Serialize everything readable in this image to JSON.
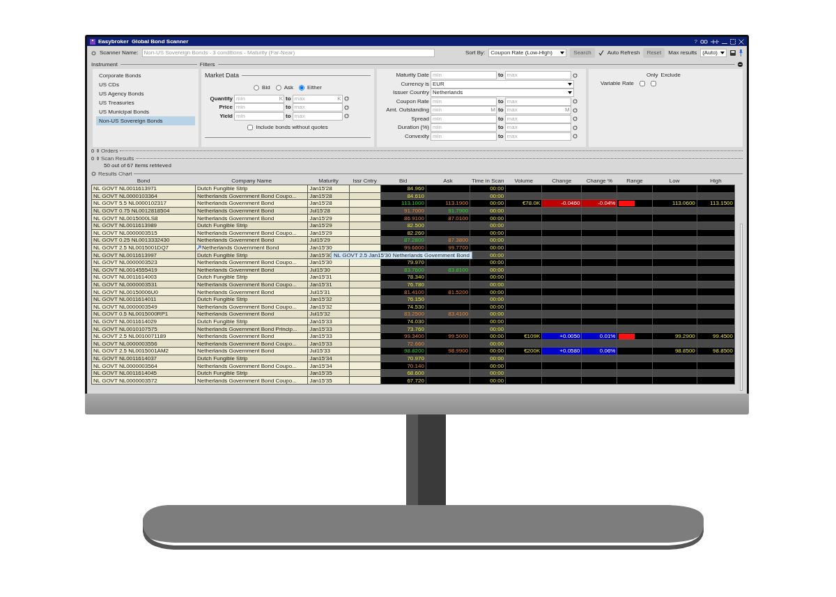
{
  "window": {
    "title": "Easybroker  Global Bond Scanner",
    "help": "?"
  },
  "toolbar": {
    "scanner_name_label": "Scanner Name:",
    "scanner_name": "Non-US Sovereign Bonds - 3 conditions - Maturity (Far-Near)",
    "sort_by_label": "Sort By:",
    "sort_by": "Coupon Rate (Low-High)",
    "search_button": "Search",
    "auto_refresh": {
      "label": "Auto Refresh",
      "checked": true
    },
    "reset_button": "Reset",
    "max_results_label": "Max results",
    "max_results": "(Auto)"
  },
  "instrument": {
    "label": "Instrument",
    "items": [
      {
        "label": "Corporate Bonds",
        "selected": false
      },
      {
        "label": "US CDs",
        "selected": false
      },
      {
        "label": "US Agency Bonds",
        "selected": false
      },
      {
        "label": "US Treasuries",
        "selected": false
      },
      {
        "label": "US Municipal Bonds",
        "selected": false
      },
      {
        "label": "Non-US Sovereign Bonds",
        "selected": true
      }
    ]
  },
  "filters": {
    "label": "Filters",
    "market_data": {
      "title": "Market Data",
      "quote_sides": [
        {
          "label": "Bid",
          "selected": false
        },
        {
          "label": "Ask",
          "selected": false
        },
        {
          "label": "Either",
          "selected": true
        }
      ],
      "rows": [
        {
          "label": "Quantity",
          "min_placeholder": "min",
          "max_placeholder": "max",
          "to": "to",
          "min_unit": "K",
          "max_unit": "K"
        },
        {
          "label": "Price",
          "min_placeholder": "min",
          "max_placeholder": "max",
          "to": "to"
        },
        {
          "label": "Yield",
          "min_placeholder": "min",
          "max_placeholder": "max",
          "to": "to"
        }
      ],
      "include_without_quotes": {
        "label": "Include bonds without quotes",
        "checked": false
      }
    },
    "criteria": [
      {
        "kind": "range",
        "label": "Maturity Date",
        "min_placeholder": "min",
        "max_placeholder": "max",
        "to": "to"
      },
      {
        "kind": "select",
        "label": "Currency is",
        "value": "EUR"
      },
      {
        "kind": "select",
        "label": "Issuer Country",
        "value": "Netherlands"
      },
      {
        "kind": "range",
        "label": "Coupon Rate",
        "min_placeholder": "min",
        "max_placeholder": "max",
        "to": "to"
      },
      {
        "kind": "range",
        "label": "Amt. Outstanding",
        "min_placeholder": "min",
        "max_placeholder": "max",
        "to": "to",
        "min_unit": "M",
        "max_unit": "M"
      },
      {
        "kind": "range",
        "label": "Spread",
        "min_placeholder": "min",
        "max_placeholder": "max",
        "to": "to"
      },
      {
        "kind": "range",
        "label": "Duration (%)",
        "min_placeholder": "min",
        "max_placeholder": "max",
        "to": "to"
      },
      {
        "kind": "range",
        "label": "Convexity",
        "min_placeholder": "min",
        "max_placeholder": "max",
        "to": "to"
      }
    ],
    "flags": {
      "headers": [
        "Only",
        "Exclude"
      ],
      "items": [
        {
          "label": "Variable Rate",
          "only": false,
          "exclude": false
        }
      ]
    }
  },
  "sections": [
    {
      "label": "Orders"
    },
    {
      "label": "Scan Results"
    }
  ],
  "scan_status": "50 out of 67 items retrieved",
  "results_chart": {
    "label": "Results Chart"
  },
  "table": {
    "columns": [
      "Bond",
      "Company Name",
      "Maturity",
      "Issr Cntry",
      "Bid",
      "Ask",
      "Time in Scan",
      "Volume",
      "Change",
      "Change %",
      "Range",
      "Low",
      "High"
    ],
    "rows": [
      {
        "bond": "NL GOVT NL0011613971",
        "company": "Dutch Fungible Strip",
        "maturity": "Jan15'28",
        "bid": {
          "text": "84.960",
          "kind": "flat"
        },
        "time": "00:00",
        "arrow": false,
        "range": false
      },
      {
        "bond": "NL GOVT NL0000103364",
        "company": "Netherlands Government Bond Coupo...",
        "maturity": "Jan15'28",
        "bid": {
          "text": "84.610",
          "kind": "flat"
        },
        "time": "00:00",
        "arrow": false,
        "range": false
      },
      {
        "bond": "NL GOVT 5.5 NL0000102317",
        "company": "Netherlands Government Bond",
        "maturity": "Jan15'28",
        "bid": {
          "text": "113.1000",
          "kind": "up"
        },
        "ask": {
          "text": "113.1900",
          "kind": "down"
        },
        "time": "00:00",
        "volume": "€78.0K",
        "change": {
          "text": "-0.0460",
          "color": "#c00000"
        },
        "change_pct": {
          "text": "-0.04%",
          "color": "#c00000"
        },
        "arrow": false,
        "range": true,
        "low": "113.0600",
        "high": "113.1500"
      },
      {
        "bond": "NL GOVT 0.75 NL0012818504",
        "company": "Netherlands Government Bond",
        "maturity": "Jul15'28",
        "bid": {
          "text": "91.7000",
          "kind": "down"
        },
        "ask": {
          "text": "91.7900",
          "kind": "up"
        },
        "time": "00:00",
        "arrow": false,
        "range": false
      },
      {
        "bond": "NL GOVT NL0015000LS8",
        "company": "Netherlands Government Bond",
        "maturity": "Jan15'29",
        "bid": {
          "text": "86.9100",
          "kind": "down"
        },
        "ask": {
          "text": "87.0100",
          "kind": "down"
        },
        "time": "00:00",
        "arrow": false,
        "range": false
      },
      {
        "bond": "NL GOVT NL0011613989",
        "company": "Dutch Fungible Strip",
        "maturity": "Jan15'29",
        "bid": {
          "text": "82.500",
          "kind": "flat"
        },
        "time": "00:00",
        "arrow": false,
        "range": false
      },
      {
        "bond": "NL GOVT NL0000003515",
        "company": "Netherlands Government Bond Coupo...",
        "maturity": "Jan15'29",
        "bid": {
          "text": "82.260",
          "kind": "flat"
        },
        "time": "00:00",
        "arrow": false,
        "range": false
      },
      {
        "bond": "NL GOVT 0.25 NL0013332430",
        "company": "Netherlands Government Bond",
        "maturity": "Jul15'29",
        "bid": {
          "text": "87.2800",
          "kind": "up"
        },
        "ask": {
          "text": "87.3800",
          "kind": "down"
        },
        "time": "00:00",
        "arrow": false,
        "range": false
      },
      {
        "bond": "NL GOVT 2.5 NL0015001DQ7",
        "company": "Netherlands Government Bond",
        "maturity": "Jan15'30",
        "bid": {
          "text": "99.6600",
          "kind": "down"
        },
        "ask": {
          "text": "99.7700",
          "kind": "down"
        },
        "time": "00:00",
        "arrow": true,
        "range": false
      },
      {
        "bond": "NL GOVT NL0011613997",
        "company": "Dutch Fungible Strip",
        "maturity": "Jan15'30",
        "time": "00:00",
        "arrow": false,
        "range": false
      },
      {
        "bond": "NL GOVT NL0000003523",
        "company": "Netherlands Government Bond Coupo...",
        "maturity": "Jan15'30",
        "bid": {
          "text": "79.970",
          "kind": "flat"
        },
        "time": "00:00",
        "arrow": false,
        "range": false
      },
      {
        "bond": "NL GOVT NL0014555419",
        "company": "Netherlands Government Bond",
        "maturity": "Jul15'30",
        "bid": {
          "text": "83.7600",
          "kind": "up"
        },
        "ask": {
          "text": "83.8100",
          "kind": "up"
        },
        "time": "00:00",
        "arrow": false,
        "range": false
      },
      {
        "bond": "NL GOVT NL0011614003",
        "company": "Dutch Fungible Strip",
        "maturity": "Jan15'31",
        "bid": {
          "text": "78.340",
          "kind": "flat"
        },
        "time": "00:00",
        "arrow": false,
        "range": false
      },
      {
        "bond": "NL GOVT NL0000003531",
        "company": "Netherlands Government Bond Coupo...",
        "maturity": "Jan15'31",
        "bid": {
          "text": "76.780",
          "kind": "flat"
        },
        "time": "00:00",
        "arrow": false,
        "range": false
      },
      {
        "bond": "NL GOVT NL00150006U0",
        "company": "Netherlands Government Bond",
        "maturity": "Jul15'31",
        "bid": {
          "text": "81.4100",
          "kind": "down"
        },
        "ask": {
          "text": "81.5200",
          "kind": "down"
        },
        "time": "00:00",
        "arrow": false,
        "range": false
      },
      {
        "bond": "NL GOVT NL0011614011",
        "company": "Dutch Fungible Strip",
        "maturity": "Jan15'32",
        "bid": {
          "text": "76.150",
          "kind": "flat"
        },
        "time": "00:00",
        "arrow": false,
        "range": false
      },
      {
        "bond": "NL GOVT NL0000003549",
        "company": "Netherlands Government Bond Coupo...",
        "maturity": "Jan15'32",
        "bid": {
          "text": "74.530",
          "kind": "flat"
        },
        "time": "00:00",
        "arrow": false,
        "range": false
      },
      {
        "bond": "NL GOVT 0.5 NL0015000RP1",
        "company": "Netherlands Government Bond",
        "maturity": "Jul15'32",
        "bid": {
          "text": "83.2500",
          "kind": "down"
        },
        "ask": {
          "text": "83.4100",
          "kind": "down"
        },
        "time": "00:00",
        "arrow": false,
        "range": false
      },
      {
        "bond": "NL GOVT NL0011614029",
        "company": "Dutch Fungible Strip",
        "maturity": "Jan15'33",
        "bid": {
          "text": "74.030",
          "kind": "flat"
        },
        "time": "00:00",
        "arrow": false,
        "range": false
      },
      {
        "bond": "NL GOVT NL0010107575",
        "company": "Netherlands Government Bond Princip...",
        "maturity": "Jan15'33",
        "bid": {
          "text": "73.760",
          "kind": "flat"
        },
        "time": "00:00",
        "arrow": false,
        "range": false
      },
      {
        "bond": "NL GOVT 2.5 NL0010071189",
        "company": "Netherlands Government Bond",
        "maturity": "Jan15'33",
        "bid": {
          "text": "99.3400",
          "kind": "down"
        },
        "ask": {
          "text": "99.5000",
          "kind": "down"
        },
        "time": "00:00",
        "volume": "€109K",
        "change": {
          "text": "+0.0050",
          "color": "#0000cc"
        },
        "change_pct": {
          "text": "0.01%",
          "color": "#0000cc"
        },
        "arrow": false,
        "range": true,
        "low": "99.2900",
        "high": "99.4500"
      },
      {
        "bond": "NL GOVT NL0000003556",
        "company": "Netherlands Government Bond Coupo...",
        "maturity": "Jan15'33",
        "bid": {
          "text": "72.660",
          "kind": "down"
        },
        "time": "00:00",
        "arrow": false,
        "range": false
      },
      {
        "bond": "NL GOVT 2.5 NL0015001AM2",
        "company": "Netherlands Government Bond",
        "maturity": "Jul15'33",
        "bid": {
          "text": "98.8200",
          "kind": "up"
        },
        "ask": {
          "text": "98.9900",
          "kind": "down"
        },
        "time": "00:00",
        "volume": "€200K",
        "change": {
          "text": "+0.0580",
          "color": "#0000cc"
        },
        "change_pct": {
          "text": "0.06%",
          "color": "#0000cc"
        },
        "arrow": false,
        "range": false,
        "low": "98.8500",
        "high": "98.8500"
      },
      {
        "bond": "NL GOVT NL0011614037",
        "company": "Dutch Fungible Strip",
        "maturity": "Jan15'34",
        "bid": {
          "text": "70.970",
          "kind": "flat"
        },
        "time": "00:00",
        "arrow": false,
        "range": false
      },
      {
        "bond": "NL GOVT NL0000003564",
        "company": "Netherlands Government Bond Coupo...",
        "maturity": "Jan15'34",
        "bid": {
          "text": "70.140",
          "kind": "down"
        },
        "time": "00:00",
        "arrow": false,
        "range": false
      },
      {
        "bond": "NL GOVT NL0011614045",
        "company": "Dutch Fungible Strip",
        "maturity": "Jan15'35",
        "bid": {
          "text": "68.600",
          "kind": "flat"
        },
        "time": "00:00",
        "arrow": false,
        "range": false
      },
      {
        "bond": "NL GOVT NL0000003572",
        "company": "Netherlands Government Bond Coupo...",
        "maturity": "Jan15'35",
        "bid": {
          "text": "67.720",
          "kind": "flat"
        },
        "time": "00:00",
        "arrow": false,
        "range": false
      }
    ]
  },
  "tooltip": "NL GOVT 2.5 Jan15'30 Netherlands Government Bond"
}
